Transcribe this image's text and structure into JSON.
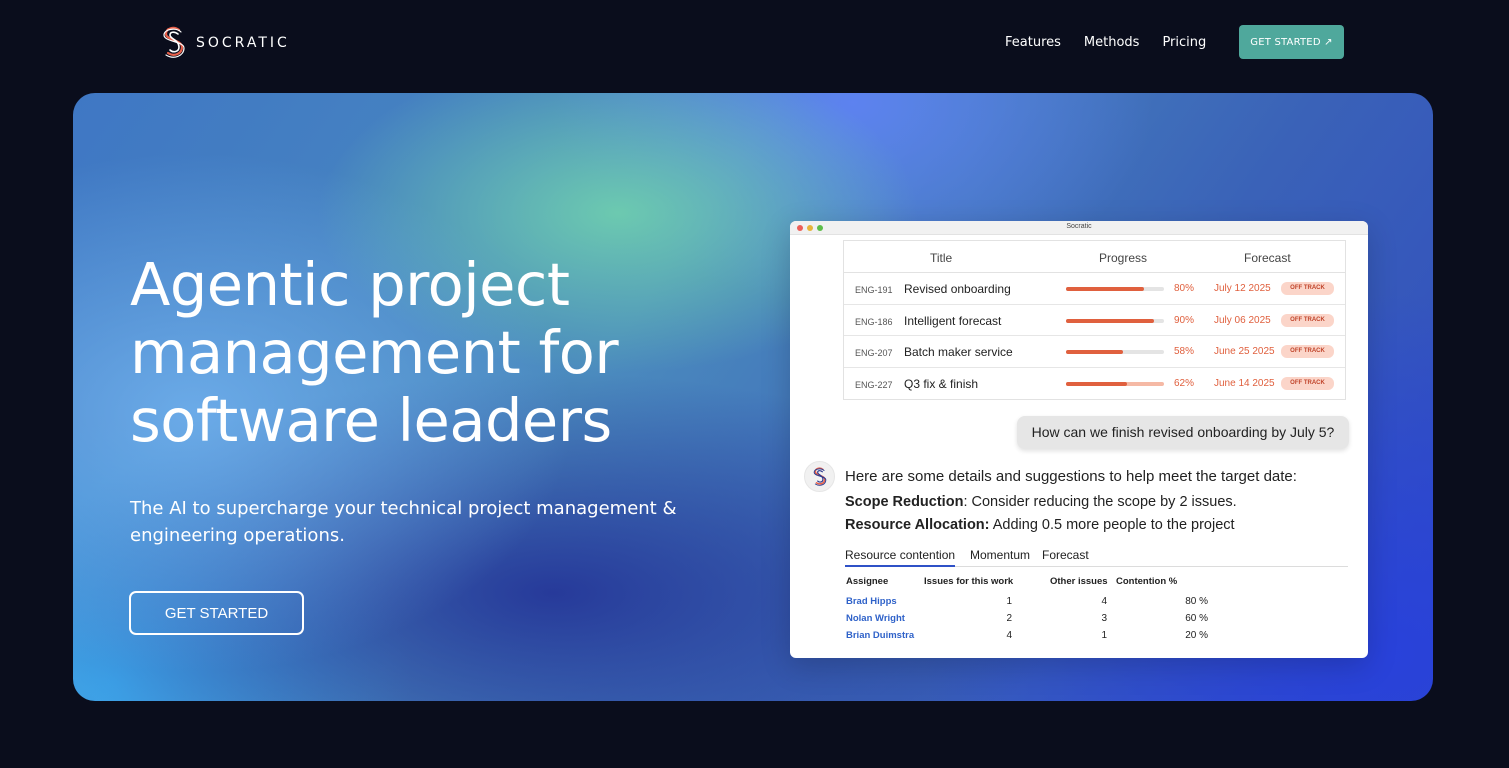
{
  "brand": {
    "name": "SOCRATIC"
  },
  "nav": {
    "links": [
      "Features",
      "Methods",
      "Pricing"
    ],
    "cta": "GET STARTED ↗"
  },
  "hero": {
    "headline": "Agentic project management for software leaders",
    "subhead": "The AI to supercharge your technical project management & engineering operations.",
    "cta": "GET STARTED",
    "colors": {
      "teal_glow": "#6ecdaf",
      "deep_blue": "#2f49c0",
      "sky_blue": "#3ca5eb"
    }
  },
  "app_window": {
    "title": "Socratic",
    "columns": [
      "Title",
      "Progress",
      "Forecast"
    ],
    "rows": [
      {
        "id": "ENG-191",
        "title": "Revised onboarding",
        "progress": 0.8,
        "progress_label": "80%",
        "forecast": "July 12 2025",
        "status": "OFF TRACK"
      },
      {
        "id": "ENG-186",
        "title": "Intelligent forecast",
        "progress": 0.9,
        "progress_label": "90%",
        "forecast": "July 06 2025",
        "status": "OFF TRACK"
      },
      {
        "id": "ENG-207",
        "title": "Batch maker service",
        "progress": 0.58,
        "progress_label": "58%",
        "forecast": "June 25 2025",
        "status": "OFF TRACK"
      },
      {
        "id": "ENG-227",
        "title": "Q3 fix & finish",
        "progress": 0.62,
        "progress_label": "62%",
        "forecast": "June 14 2025",
        "status": "OFF TRACK"
      }
    ],
    "chat": {
      "question": "How can we finish revised onboarding by July 5?",
      "answer_intro": "Here are some details and suggestions to help meet the target date:",
      "suggestions": [
        {
          "label": "Scope Reduction",
          "text": ": Consider reducing the scope by 2 issues."
        },
        {
          "label": "Resource Allocation:",
          "text": " Adding 0.5 more people to the project"
        }
      ]
    },
    "tabs": [
      "Resource contention",
      "Momentum",
      "Forecast"
    ],
    "contention": {
      "headers": [
        "Assignee",
        "Issues for this work",
        "Other issues",
        "Contention %"
      ],
      "rows": [
        {
          "name": "Brad Hipps",
          "issues": "1",
          "other": "4",
          "contention": "80 %"
        },
        {
          "name": "Nolan Wright",
          "issues": "2",
          "other": "3",
          "contention": "60 %"
        },
        {
          "name": "Brian Duimstra",
          "issues": "4",
          "other": "1",
          "contention": "20 %"
        }
      ]
    },
    "colors": {
      "accent_orange": "#e0603e",
      "badge_bg": "#fbd5c9",
      "link_blue": "#2f62c9",
      "tab_underline": "#2f51c7"
    }
  }
}
